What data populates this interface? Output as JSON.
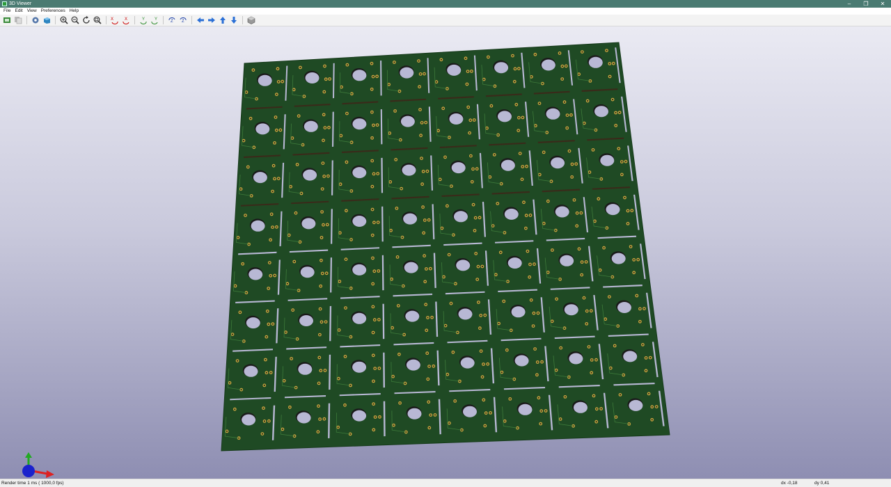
{
  "window": {
    "title": "3D Viewer"
  },
  "menu": [
    "File",
    "Edit",
    "View",
    "Preferences",
    "Help"
  ],
  "toolbar_groups": [
    [
      "render-icon",
      "copy-icon"
    ],
    [
      "settings-icon",
      "raytrace-icon"
    ],
    [
      "zoom-in-icon",
      "zoom-out-icon",
      "refresh-icon",
      "zoom-fit-icon"
    ],
    [
      "rotate-x-cw-icon",
      "rotate-x-ccw-icon"
    ],
    [
      "rotate-y-cw-icon",
      "rotate-y-ccw-icon"
    ],
    [
      "rotate-z-cw-icon",
      "rotate-z-ccw-icon"
    ],
    [
      "pan-left-icon",
      "pan-right-icon",
      "pan-up-icon",
      "pan-down-icon"
    ],
    [
      "ortho-toggle-icon"
    ]
  ],
  "board": {
    "rows": 8,
    "cols": 8,
    "color": "#1f4a24",
    "hole_color": "#b8b8d4",
    "pad_color": "#c9a840"
  },
  "status": {
    "text": "Render time 1 ms ( 1000,0 fps)",
    "dx": "dx -0,18",
    "dy": "dy 0,41"
  }
}
